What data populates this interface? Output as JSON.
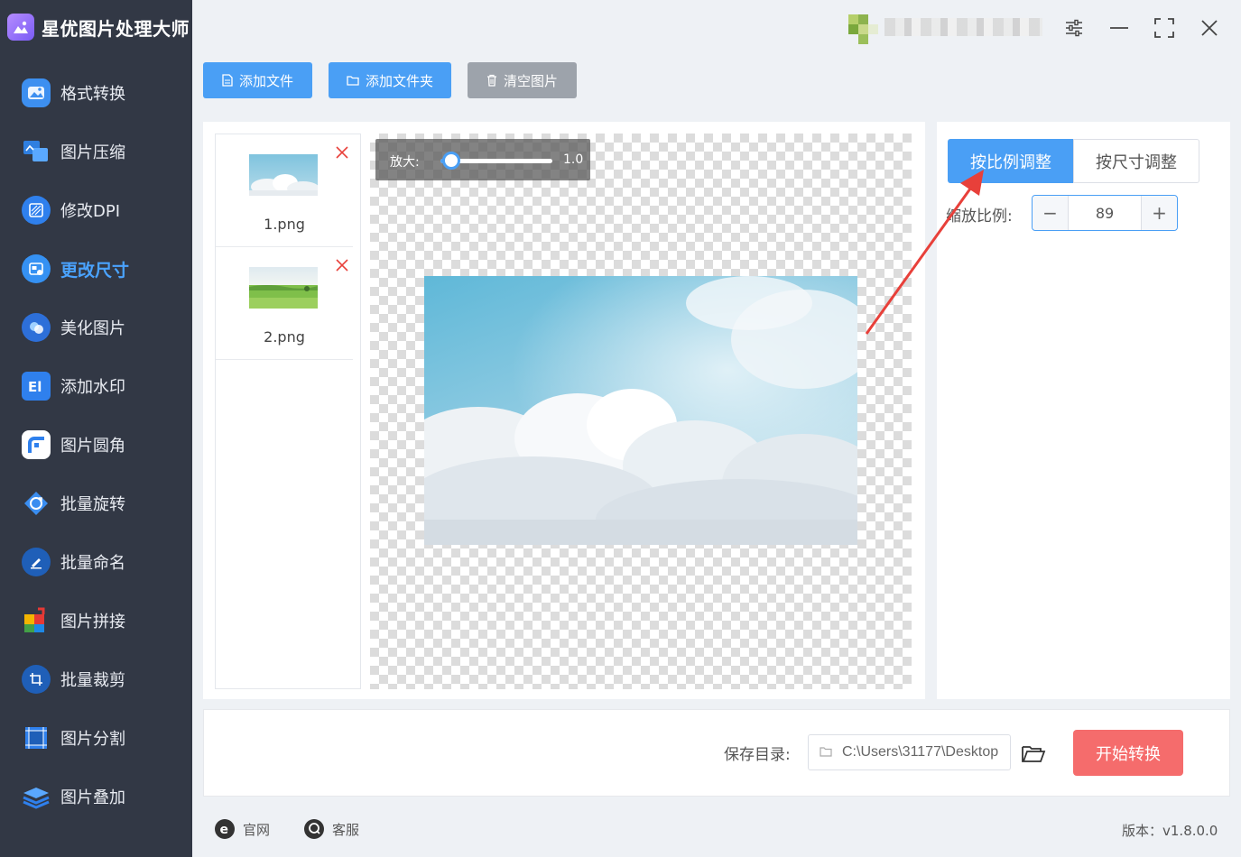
{
  "app": {
    "title": "星优图片处理大师",
    "version_text": "版本：v1.8.0.0"
  },
  "sidebar": {
    "items": [
      {
        "label": "格式转换",
        "icon": "format-convert-icon"
      },
      {
        "label": "图片压缩",
        "icon": "compress-icon"
      },
      {
        "label": "修改DPI",
        "icon": "dpi-icon"
      },
      {
        "label": "更改尺寸",
        "icon": "resize-icon",
        "active": true
      },
      {
        "label": "美化图片",
        "icon": "beautify-icon"
      },
      {
        "label": "添加水印",
        "icon": "watermark-icon"
      },
      {
        "label": "图片圆角",
        "icon": "rounded-corner-icon"
      },
      {
        "label": "批量旋转",
        "icon": "rotate-icon"
      },
      {
        "label": "批量命名",
        "icon": "rename-icon"
      },
      {
        "label": "图片拼接",
        "icon": "stitch-icon"
      },
      {
        "label": "批量裁剪",
        "icon": "crop-icon"
      },
      {
        "label": "图片分割",
        "icon": "split-icon"
      },
      {
        "label": "图片叠加",
        "icon": "overlay-icon"
      }
    ]
  },
  "toolbar": {
    "add_file": "添加文件",
    "add_folder": "添加文件夹",
    "clear": "清空图片"
  },
  "files": [
    {
      "name": "1.png"
    },
    {
      "name": "2.png"
    }
  ],
  "preview": {
    "zoom_label": "放大:",
    "zoom_value": "1.0",
    "zoom_level": 0.1
  },
  "settings": {
    "tab_ratio": "按比例调整",
    "tab_size": "按尺寸调整",
    "scale_label": "缩放比例:",
    "scale_value": "89",
    "minus": "−",
    "plus": "+"
  },
  "output": {
    "save_label": "保存目录:",
    "save_path": "C:\\Users\\31177\\Desktop",
    "start_button": "开始转换"
  },
  "footer": {
    "website": "官网",
    "support": "客服"
  },
  "colors": {
    "sidebar_bg": "#323845",
    "accent": "#4a9ff5",
    "start": "#f56c6c",
    "annotation": "#e8403a"
  }
}
